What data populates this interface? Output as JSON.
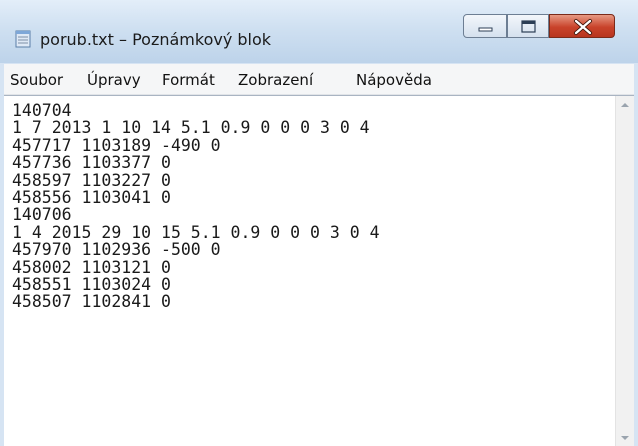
{
  "window": {
    "title": "porub.txt – Poznámkový blok"
  },
  "icons": {
    "app": "notepad-icon",
    "minimize": "minimize-icon",
    "maximize": "maximize-icon",
    "close": "close-icon",
    "scroll_up": "arrow-up-icon",
    "scroll_down": "arrow-down-icon"
  },
  "menu": {
    "items": [
      "Soubor",
      "Úpravy",
      "Formát",
      "Zobrazení",
      "Nápověda"
    ]
  },
  "editor": {
    "content": "140704\n1 7 2013 1 10 14 5.1 0.9 0 0 0 3 0 4\n457717 1103189 -490 0\n457736 1103377 0\n458597 1103227 0\n458556 1103041 0\n140706\n1 4 2015 29 10 15 5.1 0.9 0 0 0 3 0 4\n457970 1102936 -500 0\n458002 1103121 0\n458551 1103024 0\n458507 1102841 0"
  }
}
